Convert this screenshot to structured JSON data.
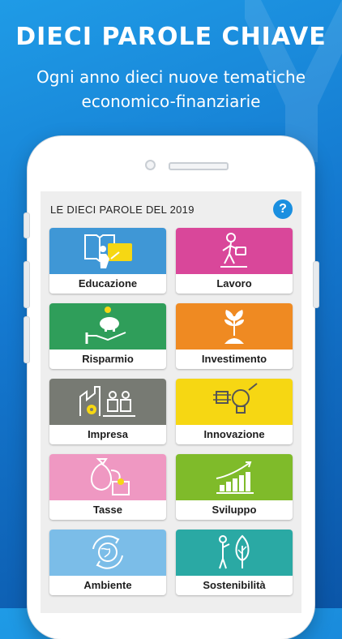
{
  "headline": "DIECI PAROLE CHIAVE",
  "subheadline_line1": "Ogni anno dieci nuove tematiche",
  "subheadline_line2": "economico-finanziarie",
  "screen": {
    "title": "LE DIECI PAROLE DEL 2019",
    "help_label": "?"
  },
  "cards": [
    {
      "label": "Educazione",
      "color": "#3f97d6",
      "icon": "book-icon"
    },
    {
      "label": "Lavoro",
      "color": "#d9479a",
      "icon": "worker-icon"
    },
    {
      "label": "Risparmio",
      "color": "#2f9e5a",
      "icon": "piggy-bank-icon"
    },
    {
      "label": "Investimento",
      "color": "#ef8a22",
      "icon": "plant-icon"
    },
    {
      "label": "Impresa",
      "color": "#777a73",
      "icon": "factory-icon"
    },
    {
      "label": "Innovazione",
      "color": "#f6d713",
      "icon": "lightbulb-chip-icon"
    },
    {
      "label": "Tasse",
      "color": "#ef98c2",
      "icon": "money-bag-icon"
    },
    {
      "label": "Sviluppo",
      "color": "#7fbb2a",
      "icon": "growth-chart-icon"
    },
    {
      "label": "Ambiente",
      "color": "#7bbde8",
      "icon": "globe-icon"
    },
    {
      "label": "Sostenibilità",
      "color": "#2aa9a4",
      "icon": "person-tree-icon"
    }
  ]
}
